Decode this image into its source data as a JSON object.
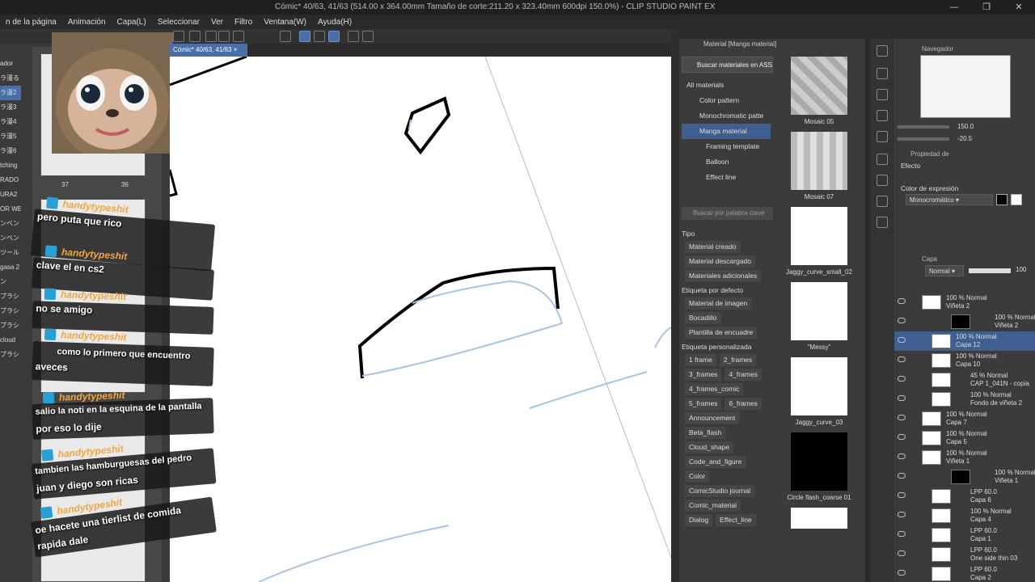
{
  "app": {
    "title": "Cómic* 40/63, 41/63 (514.00 x 364.00mm Tamaño de corte:211.20 x 323.40mm 600dpi 150.0%) - CLIP STUDIO PAINT EX",
    "window_controls": [
      "—",
      "❐",
      "✕"
    ]
  },
  "menu": [
    "n de la página",
    "Animación",
    "Capa(L)",
    "Seleccionar",
    "Ver",
    "Filtro",
    "Ventana(W)",
    "Ayuda(H)"
  ],
  "left_labels": [
    "ador",
    "ラ漫る",
    "ラ漫2",
    "ラ漫3",
    "ラ漫4",
    "ラ漫5",
    "ラ漫6",
    "tching",
    "RADO",
    "URA2",
    "OR WE",
    "ンベン",
    "ンベン",
    "ツール",
    "gasa 2",
    "ン",
    "プラシ",
    "プラシ",
    "プラシ",
    "cloud",
    "プラシ"
  ],
  "page_numbers": {
    "left": "37",
    "right": "36"
  },
  "canvas_tab": "Cómic* 40/63, 41/63",
  "material_panel": {
    "header": "Material [Manga material]",
    "search_assets": "Buscar materiales en ASSETS",
    "tree": [
      "All materials",
      "Color pattern",
      "Monochromatic patte",
      "Manga material",
      "Framing template",
      "Balloon",
      "Effect line"
    ],
    "keyword_placeholder": "Buscar por palabra clave",
    "sections": {
      "tipo": "Tipo",
      "default_tag": "Etiqueta por defecto",
      "custom_tag": "Etiqueta personalizada"
    },
    "tipo_tags": [
      "Material creado",
      "Material descargado",
      "Materiales adicionales"
    ],
    "default_tags": [
      "Material de imagen",
      "Bocadillo",
      "Plantilla de encuadre"
    ],
    "custom_tags": [
      [
        "1 frame",
        "2_frames"
      ],
      [
        "3_frames",
        "4_frames"
      ],
      [
        "4_frames_comic"
      ],
      [
        "5_frames",
        "6_frames"
      ],
      [
        "Announcement"
      ],
      [
        "Beta_flash"
      ],
      [
        "Cloud_shape"
      ],
      [
        "Code_and_figure"
      ],
      [
        "Color"
      ],
      [
        "ComicStudio journal"
      ],
      [
        "Comic_material"
      ],
      [
        "Dialog",
        "Effect_line"
      ]
    ],
    "thumbnails": [
      "Mosaic 05",
      "Mosaic 07",
      "Jaggy_curve_small_02",
      "\"Messy\"",
      "Jaggy_curve_03",
      "Circle flash_coarse 01"
    ]
  },
  "navigator": {
    "header": "Navegador",
    "zoom": "150.0",
    "angle": "-20.5"
  },
  "properties": {
    "header": "Propiedad de",
    "effect_label": "Efecto",
    "expression_color_label": "Color de expresión",
    "expression_color_value": "Monocromático"
  },
  "layers": {
    "header": "Capa",
    "blend_mode": "Normal",
    "opacity": "100",
    "items": [
      {
        "mode": "100 % Normal",
        "name": "Viñeta 2"
      },
      {
        "mode": "100 % Normal",
        "name": "Viñeta 2",
        "folder": true
      },
      {
        "mode": "100 % Normal",
        "name": "Capa 12",
        "selected": true
      },
      {
        "mode": "100 % Normal",
        "name": "Capa 10"
      },
      {
        "mode": "45 % Normal",
        "name": "CAP 1_041N - copia"
      },
      {
        "mode": "100 % Normal",
        "name": "Fondo de viñeta 2"
      },
      {
        "mode": "100 % Normal",
        "name": "Capa 7"
      },
      {
        "mode": "100 % Normal",
        "name": "Capa 5"
      },
      {
        "mode": "100 % Normal",
        "name": "Viñeta 1"
      },
      {
        "mode": "100 % Normal",
        "name": "Viñeta 1",
        "folder": true
      },
      {
        "mode": "LPP 60.0",
        "name": "Capa 6"
      },
      {
        "mode": "100 % Normal",
        "name": "Capa 4"
      },
      {
        "mode": "LPP 60.0",
        "name": "Capa 1"
      },
      {
        "mode": "LPP 60.0",
        "name": "One side thin 03"
      },
      {
        "mode": "LPP 60.0",
        "name": "Capa 2"
      }
    ]
  },
  "chat": [
    {
      "user": "handytypeshit",
      "lines": [
        "pero puta que rico"
      ]
    },
    {
      "user": "handytypeshit",
      "lines": [
        "clave el      en cs2"
      ]
    },
    {
      "user": "handytypeshit",
      "lines": [
        "no se amigo"
      ]
    },
    {
      "user": "handytypeshit",
      "lines": [
        "como lo primero que encuentro",
        "aveces"
      ]
    },
    {
      "user": "handytypeshit",
      "lines": [
        "salio la noti en la esquina de la pantalla",
        "por eso lo dije"
      ]
    },
    {
      "user": "handytypeshit",
      "lines": [
        "tambien las hamburguesas del pedro",
        "juan y diego son ricas"
      ]
    },
    {
      "user": "handytypeshit",
      "lines": [
        "oe      hacete una tierlist de comida",
        "rapida dale"
      ]
    }
  ]
}
